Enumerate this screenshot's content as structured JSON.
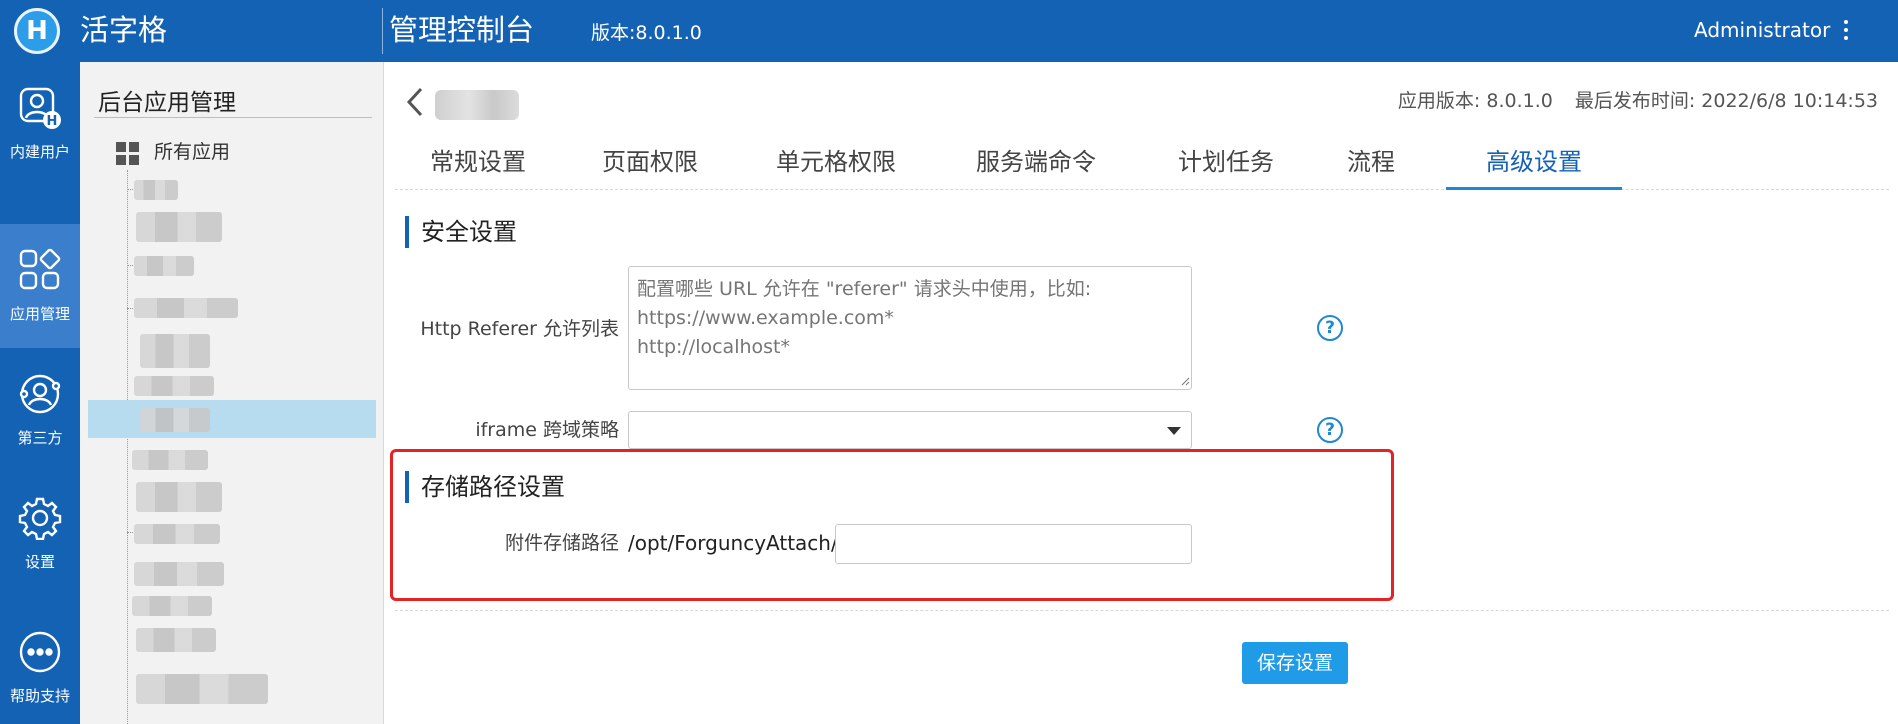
{
  "header": {
    "logo_letter": "H",
    "app_name": "活字格",
    "console_title": "管理控制台",
    "version": "版本:8.0.1.0",
    "user": "Administrator"
  },
  "leftnav": {
    "items": [
      {
        "label": "内建用户",
        "icon": "user-badge-icon"
      },
      {
        "label": "应用管理",
        "icon": "apps-grid-icon"
      },
      {
        "label": "第三方",
        "icon": "third-party-icon"
      },
      {
        "label": "设置",
        "icon": "gear-icon"
      },
      {
        "label": "帮助支持",
        "icon": "more-circle-icon"
      }
    ],
    "active": "应用管理"
  },
  "tree": {
    "title": "后台应用管理",
    "root_label": "所有应用"
  },
  "app_meta": {
    "version": "应用版本: 8.0.1.0",
    "published": "最后发布时间: 2022/6/8 10:14:53"
  },
  "tabs": [
    {
      "label": "常规设置"
    },
    {
      "label": "页面权限"
    },
    {
      "label": "单元格权限"
    },
    {
      "label": "服务端命令"
    },
    {
      "label": "计划任务"
    },
    {
      "label": "流程"
    },
    {
      "label": "高级设置"
    }
  ],
  "active_tab": "高级设置",
  "security": {
    "heading": "安全设置",
    "referer_label": "Http Referer 允许列表",
    "referer_placeholder": "配置哪些 URL 允许在 \"referer\" 请求头中使用，比如:\nhttps://www.example.com*\nhttp://localhost*",
    "iframe_label": "iframe 跨域策略",
    "iframe_value": "",
    "help_glyph": "?"
  },
  "storage": {
    "heading": "存储路径设置",
    "path_label": "附件存储路径",
    "path_prefix": "/opt/ForguncyAttach/",
    "path_value": ""
  },
  "save_button": "保存设置",
  "colors": {
    "brand": "#1462b4",
    "accent": "#1f9be7",
    "highlight": "#e52323"
  }
}
